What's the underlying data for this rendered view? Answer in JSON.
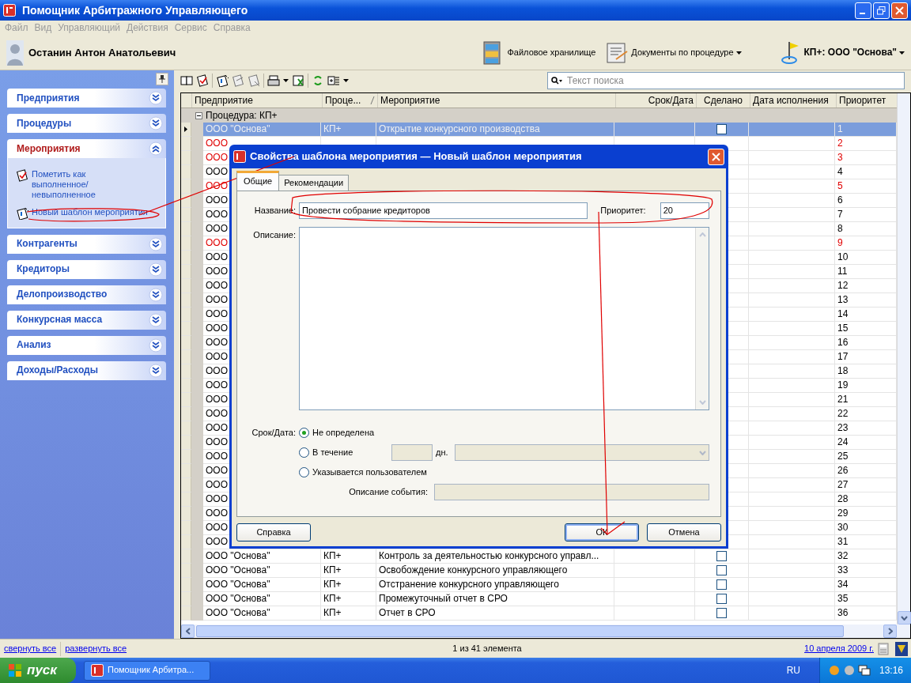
{
  "window": {
    "title": "Помощник Арбитражного Управляющего"
  },
  "menu": [
    "Файл",
    "Вид",
    "Управляющий",
    "Действия",
    "Сервис",
    "Справка"
  ],
  "header": {
    "user_name": "Останин Антон Анатольевич",
    "links": [
      {
        "label": "Файловое хранилище",
        "dropdown": false
      },
      {
        "label": "Документы по процедуре",
        "dropdown": true
      }
    ],
    "procedure": "КП+: ООО \"Основа\""
  },
  "search": {
    "placeholder": "Текст поиска"
  },
  "sidebar": [
    {
      "title": "Предприятия",
      "expanded": false
    },
    {
      "title": "Процедуры",
      "expanded": false
    },
    {
      "title": "Мероприятия",
      "expanded": true,
      "items": [
        "Пометить как выполненное/невыполненное",
        "Новый шаблон мероприятия"
      ]
    },
    {
      "title": "Контрагенты",
      "expanded": false
    },
    {
      "title": "Кредиторы",
      "expanded": false
    },
    {
      "title": "Делопроизводство",
      "expanded": false
    },
    {
      "title": "Конкурсная масса",
      "expanded": false
    },
    {
      "title": "Анализ",
      "expanded": false
    },
    {
      "title": "Доходы/Расходы",
      "expanded": false
    }
  ],
  "table": {
    "columns": [
      "Предприятие",
      "Проце...",
      "Мероприятие",
      "Срок/Дата",
      "Сделано",
      "Дата исполнения",
      "Приоритет"
    ],
    "group": "Процедура: КП+",
    "rows": [
      {
        "company": "ООО \"Основа\"",
        "procedure": "КП+",
        "event": "Открытие конкурсного производства",
        "done": false,
        "priority": "1",
        "overdue": false,
        "selected": true
      },
      {
        "company": "ООО",
        "priority": "2",
        "overdue": true,
        "selected": false
      },
      {
        "company": "ООО",
        "priority": "3",
        "overdue": true,
        "selected": false
      },
      {
        "company": "ООО",
        "priority": "4",
        "overdue": false,
        "selected": false
      },
      {
        "company": "ООО",
        "priority": "5",
        "overdue": true,
        "selected": false
      },
      {
        "company": "ООО",
        "priority": "6",
        "overdue": false,
        "selected": false
      },
      {
        "company": "ООО",
        "priority": "7",
        "overdue": false,
        "selected": false
      },
      {
        "company": "ООО",
        "priority": "8",
        "overdue": false,
        "selected": false
      },
      {
        "company": "ООО",
        "priority": "9",
        "overdue": true,
        "selected": false
      },
      {
        "company": "ООО",
        "priority": "10",
        "overdue": false,
        "selected": false
      },
      {
        "company": "ООО",
        "priority": "11",
        "overdue": false,
        "selected": false
      },
      {
        "company": "ООО",
        "priority": "12",
        "overdue": false,
        "selected": false
      },
      {
        "company": "ООО",
        "priority": "13",
        "overdue": false,
        "selected": false
      },
      {
        "company": "ООО",
        "priority": "14",
        "overdue": false,
        "selected": false
      },
      {
        "company": "ООО",
        "priority": "15",
        "overdue": false,
        "selected": false
      },
      {
        "company": "ООО",
        "priority": "16",
        "overdue": false,
        "selected": false
      },
      {
        "company": "ООО",
        "priority": "17",
        "overdue": false,
        "selected": false
      },
      {
        "company": "ООО",
        "priority": "18",
        "overdue": false,
        "selected": false
      },
      {
        "company": "ООО",
        "priority": "19",
        "overdue": false,
        "selected": false
      },
      {
        "company": "ООО",
        "priority": "21",
        "overdue": false,
        "selected": false
      },
      {
        "company": "ООО",
        "priority": "22",
        "overdue": false,
        "selected": false
      },
      {
        "company": "ООО",
        "priority": "23",
        "overdue": false,
        "selected": false
      },
      {
        "company": "ООО",
        "priority": "24",
        "overdue": false,
        "selected": false
      },
      {
        "company": "ООО",
        "priority": "25",
        "overdue": false,
        "selected": false
      },
      {
        "company": "ООО",
        "priority": "26",
        "overdue": false,
        "selected": false
      },
      {
        "company": "ООО",
        "priority": "27",
        "overdue": false,
        "selected": false
      },
      {
        "company": "ООО",
        "priority": "28",
        "overdue": false,
        "selected": false
      },
      {
        "company": "ООО",
        "priority": "29",
        "overdue": false,
        "selected": false
      },
      {
        "company": "ООО",
        "priority": "30",
        "overdue": false,
        "selected": false
      },
      {
        "company": "ООО",
        "priority": "31",
        "overdue": false,
        "selected": false
      },
      {
        "company": "ООО \"Основа\"",
        "procedure": "КП+",
        "event": "Контроль за деятельностью конкурсного управл...",
        "done": false,
        "priority": "32",
        "overdue": false,
        "selected": false
      },
      {
        "company": "ООО \"Основа\"",
        "procedure": "КП+",
        "event": "Освобождение конкурсного управляющего",
        "done": false,
        "priority": "33",
        "overdue": false,
        "selected": false
      },
      {
        "company": "ООО \"Основа\"",
        "procedure": "КП+",
        "event": "Отстранение конкурсного управляющего",
        "done": false,
        "priority": "34",
        "overdue": false,
        "selected": false
      },
      {
        "company": "ООО \"Основа\"",
        "procedure": "КП+",
        "event": "Промежуточный отчет в СРО",
        "done": false,
        "priority": "35",
        "overdue": false,
        "selected": false
      },
      {
        "company": "ООО \"Основа\"",
        "procedure": "КП+",
        "event": "Отчет в СРО",
        "done": false,
        "priority": "36",
        "overdue": false,
        "selected": false
      }
    ]
  },
  "dialog": {
    "title": "Свойства шаблона мероприятия — Новый шаблон мероприятия",
    "tabs": [
      {
        "label": "Общие",
        "selected": true
      },
      {
        "label": "Рекомендации",
        "selected": false
      }
    ],
    "name_label": "Название:",
    "name_value": "Провести собрание кредиторов",
    "priority_label": "Приоритет:",
    "priority_value": "20",
    "description_label": "Описание:",
    "deadline_label": "Срок/Дата:",
    "options": [
      {
        "kind": "plain",
        "label": "Не определена",
        "selected": true
      },
      {
        "kind": "period",
        "label": "В течение",
        "unit": "дн.",
        "selected": false
      },
      {
        "kind": "user",
        "label": "Указывается пользователем",
        "field_label": "Описание события:",
        "selected": false
      }
    ],
    "buttons": [
      {
        "label": "Справка",
        "default": false
      },
      {
        "label": "ОК",
        "default": true
      },
      {
        "label": "Отмена",
        "default": false
      }
    ]
  },
  "status_bar": {
    "links": [
      "свернуть все",
      "развернуть все"
    ],
    "count": "1 из 41 элемента",
    "date": "10 апреля 2009 г."
  },
  "taskbar": {
    "start": "пуск",
    "task": "Помощник Арбитра...",
    "language": "RU",
    "clock": "13:16"
  }
}
